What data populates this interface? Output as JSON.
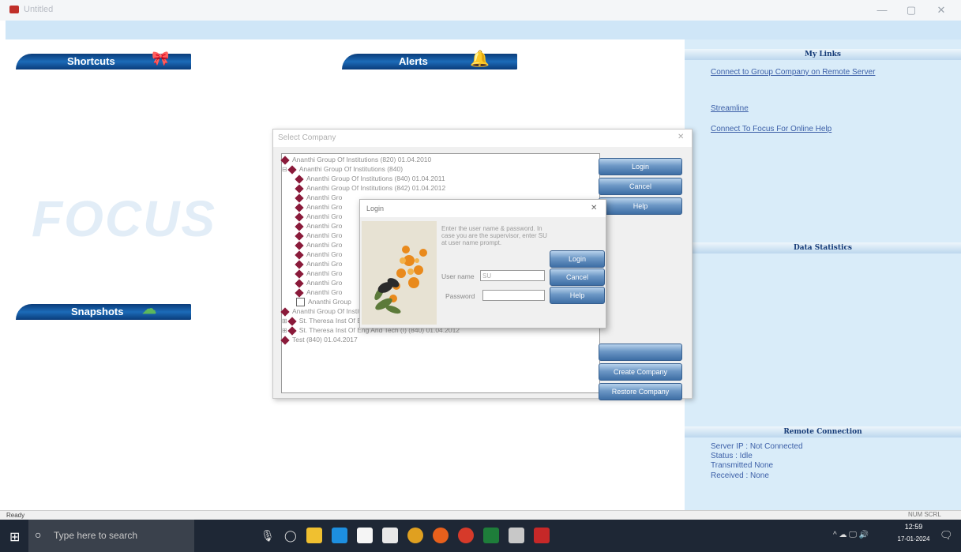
{
  "window": {
    "title": "Untitled",
    "minimize": "—",
    "maximize": "▢",
    "close": "✕"
  },
  "banners": {
    "shortcuts": "Shortcuts",
    "alerts": "Alerts",
    "snapshots": "Snapshots"
  },
  "logo_text": "FOCUS",
  "right_panel": {
    "my_links_title": "My Links",
    "links": [
      "Connect to Group Company on Remote Server",
      "Streamline",
      "Connect To Focus For Online Help"
    ],
    "data_statistics_title": "Data Statistics",
    "remote_connection_title": "Remote Connection",
    "remote_info": [
      "Server IP : Not Connected",
      "Status :   Idle",
      "Transmitted None",
      "Received :  None"
    ]
  },
  "select_company": {
    "title": "Select Company",
    "close": "✕",
    "tree": [
      "Ananthi Group Of Institutions (820) 01.04.2010",
      "Ananthi Group Of Institutions (840)",
      "Ananthi Group Of Institutions (840) 01.04.2011",
      "Ananthi Group Of Institutions (842) 01.04.2012",
      "Ananthi Gro",
      "Ananthi Gro",
      "Ananthi Gro",
      "Ananthi Gro",
      "Ananthi Gro",
      "Ananthi Gro",
      "Ananthi Gro",
      "Ananthi Gro",
      "Ananthi Gro",
      "Ananthi Gro",
      "Ananthi Gro",
      "Ananthi Group",
      "Ananthi Group Of Institutions (730) 01.04.2014",
      "St. Theresa Inst Of Eng And Tech (I31)",
      "St. Theresa Inst Of Eng And Tech (I) (840) 01.04.2012",
      "Test (840) 01.04.2017"
    ],
    "buttons": [
      "Login",
      "Cancel",
      "Help",
      "",
      "Create Company",
      "Restore Company"
    ]
  },
  "login": {
    "title": "Login",
    "close": "✕",
    "message": "Enter the user name & password. In case you are the supervisor, enter SU at user name prompt.",
    "username_label": "User name",
    "username_value": "SU",
    "password_label": "Password",
    "buttons": [
      "Login",
      "Cancel",
      "Help"
    ]
  },
  "status": {
    "text": "Ready",
    "indicators": "NUM  SCRL"
  },
  "taskbar": {
    "search_placeholder": "Type here to search",
    "time": "12:59",
    "date": "17-01-2024"
  }
}
